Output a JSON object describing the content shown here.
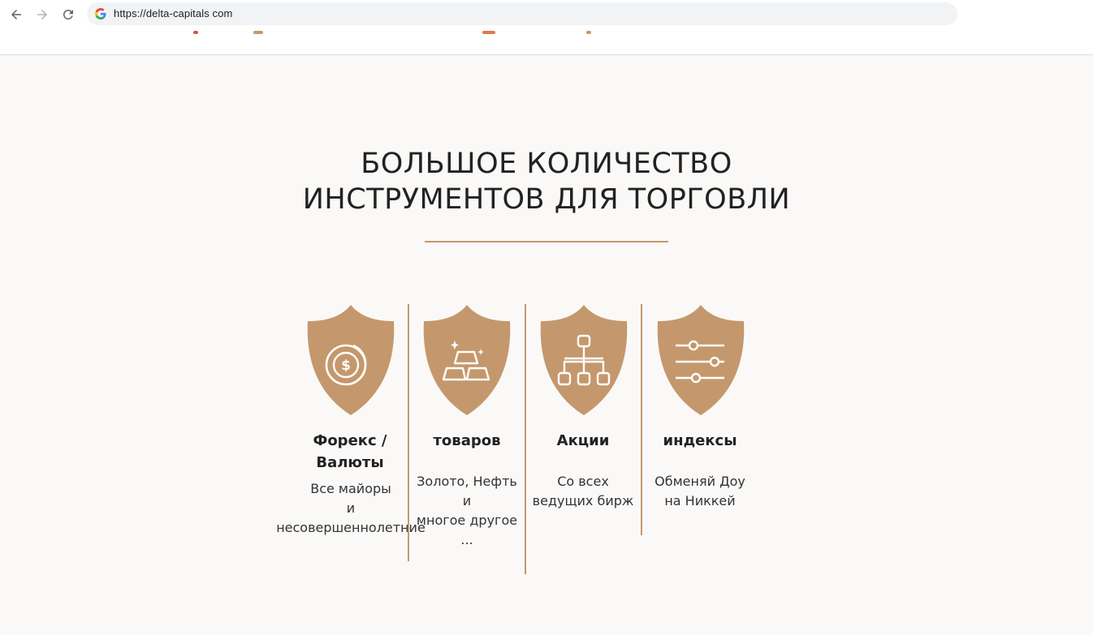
{
  "browser": {
    "url": "https://delta-capitals com"
  },
  "section": {
    "title_line1": "БОЛЬШОЕ КОЛИЧЕСТВО",
    "title_line2": "ИНСТРУМЕНТОВ ДЛЯ ТОРГОВЛИ"
  },
  "features": [
    {
      "icon": "coins-dollar-icon",
      "title_line1": "Форекс /",
      "title_line2": "Валюты",
      "desc_lines": [
        "Все майоры",
        "и",
        "несовершеннолетние"
      ]
    },
    {
      "icon": "gold-bars-icon",
      "title_line1": "товаров",
      "desc_lines": [
        "Золото, Нефть",
        "и",
        "многое другое",
        "..."
      ]
    },
    {
      "icon": "hierarchy-icon",
      "title_line1": "Акции",
      "desc_lines": [
        "Со всех",
        "ведущих бирж"
      ]
    },
    {
      "icon": "sliders-icon",
      "title_line1": "индексы",
      "desc_lines": [
        "Обменяй Доу",
        "на Никкей"
      ]
    }
  ],
  "colors": {
    "accent": "#c49a6c",
    "shield": "#c4986c",
    "background": "#faf9f8",
    "text": "#222222"
  }
}
